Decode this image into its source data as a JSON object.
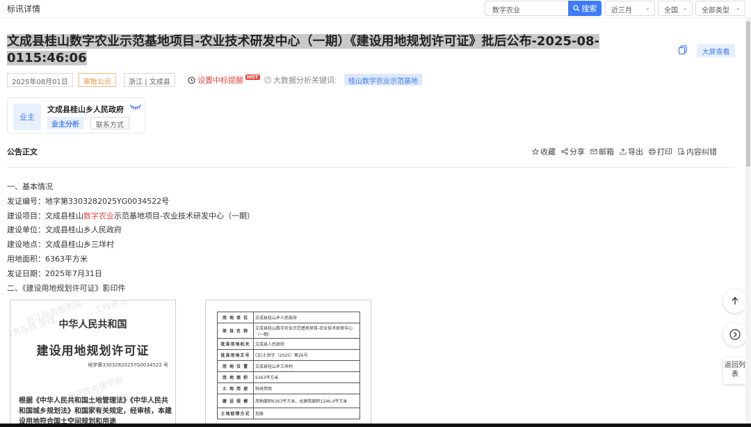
{
  "header": {
    "title": "标讯详情",
    "search_value": "数字农业",
    "search_button": "搜索",
    "filters": [
      "近三月",
      "全国",
      "全部类型"
    ]
  },
  "notice": {
    "title": "文成县桂山数字农业示范基地项目-农业技术研发中心（一期）《建设用地规划许可证》批后公布-2025-08-0115:46:06",
    "big_screen": "大屏查看",
    "date": "2025年08月01日",
    "type": "审批公示",
    "region": "浙江 | 文成县",
    "remind": "设置中标提醒",
    "hot": "HOT",
    "keyword_label": "大数据分析关键词:",
    "keyword": "桂山数字农业示范基地"
  },
  "owner": {
    "avatar_label": "业主",
    "name": "文成县桂山乡人民政府",
    "analysis": "业主分析",
    "contact": "联系方式"
  },
  "section": {
    "title": "公告正文",
    "actions": [
      "收藏",
      "分享",
      "邮箱",
      "导出",
      "打印",
      "内容纠错"
    ]
  },
  "content": {
    "h1": "一、基本情况",
    "cert_no": "发证编号：地字第3303282025YG0034522号",
    "project_prefix": "建设项目：文成县桂山",
    "project_highlight": "数字农业",
    "project_suffix": "示范基地项目-农业技术研发中心（一期）",
    "unit": "建设单位：文成县桂山乡人民政府",
    "location": "建设地点：文成县桂山乡三垟村",
    "area": "用地面积：6363平方米",
    "issue_date": "发证日期：2025年7月31日",
    "h2": "二、《建设用地规划许可证》影印件"
  },
  "doc1": {
    "country": "中华人民共和国",
    "cert_title": "建设用地规划许可证",
    "cert_no": "地字第3303282025YG0034522 号",
    "paragraph": "根据《中华人民共和国土地管理法》《中华人民共和国城乡规划法》和国家有关规定，经审核，本建设用地符合国土空间规划和用途"
  },
  "doc2": {
    "rows": [
      {
        "k": "用 地 单 位",
        "v": "文成县桂山乡人民政府"
      },
      {
        "k": "项 目 名 称",
        "v": "文成县桂山数字农业示范基地项目-农业技术研发中心（一期）"
      },
      {
        "k": "批准用地机关",
        "v": "文成县人民政府"
      },
      {
        "k": "批准用地文号",
        "v": "(文)土供字（2025）第26号"
      },
      {
        "k": "用 地 位 置",
        "v": "文成县桂山乡三垟村"
      },
      {
        "k": "用 地 面 积",
        "v": "6363平方米"
      },
      {
        "k": "土 地 用 途",
        "v": "科研用地"
      },
      {
        "k": "建 设 规 模",
        "v": "用地面积6363平方米，总建筑面积1246.4平方米"
      },
      {
        "k": "土地取得方式",
        "v": "划拨"
      }
    ]
  },
  "floating": {
    "back_list": "返回列表"
  }
}
